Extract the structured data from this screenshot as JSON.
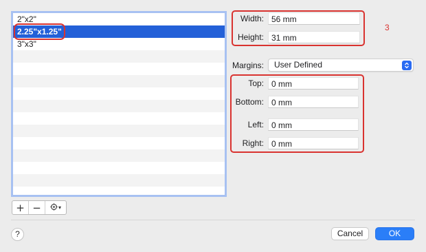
{
  "paper_sizes": [
    {
      "label": "2\"x2\"",
      "selected": false
    },
    {
      "label": "2.25\"x1.25\"",
      "selected": true
    },
    {
      "label": "3\"x3\"",
      "selected": false
    }
  ],
  "list_buttons": {
    "add": "+",
    "remove": "−",
    "action": "⚙"
  },
  "size": {
    "width_label": "Width:",
    "width_value": "56 mm",
    "height_label": "Height:",
    "height_value": "31 mm"
  },
  "annotation": "3",
  "margins": {
    "label": "Margins:",
    "selected": "User Defined",
    "top_label": "Top:",
    "top_value": "0 mm",
    "bottom_label": "Bottom:",
    "bottom_value": "0 mm",
    "left_label": "Left:",
    "left_value": "0 mm",
    "right_label": "Right:",
    "right_value": "0 mm"
  },
  "footer": {
    "help": "?",
    "cancel": "Cancel",
    "ok": "OK"
  },
  "colors": {
    "selection": "#2360d8",
    "highlight": "#d9322f",
    "accent": "#2a7ef8"
  }
}
